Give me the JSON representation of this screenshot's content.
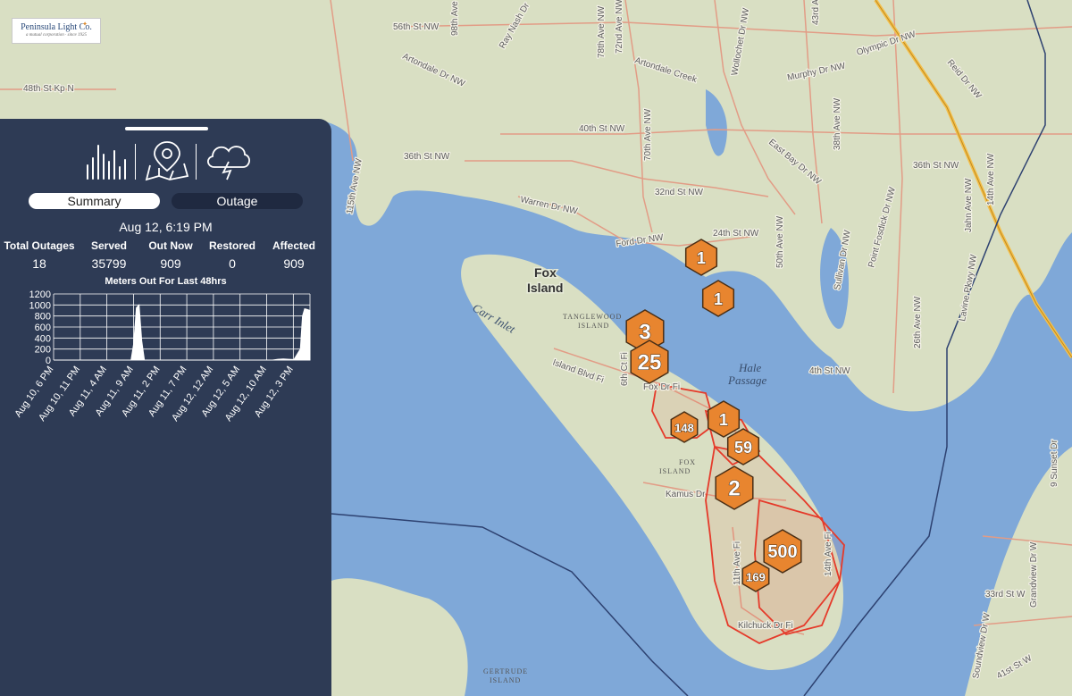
{
  "logo": {
    "name": "Peninsula Light Co.",
    "tagline": "a mutual corporation · since 1925"
  },
  "panel": {
    "icons": [
      "bar-chart-icon",
      "map-pin-icon",
      "storm-cloud-icon"
    ],
    "tabs": {
      "summary": "Summary",
      "outage": "Outage"
    },
    "timestamp": "Aug 12, 6:19 PM",
    "stats": [
      {
        "label": "Total Outages",
        "value": "18"
      },
      {
        "label": "Served",
        "value": "35799"
      },
      {
        "label": "Out Now",
        "value": "909"
      },
      {
        "label": "Restored",
        "value": "0"
      },
      {
        "label": "Affected",
        "value": "909"
      }
    ]
  },
  "chart_data": {
    "type": "area",
    "title": "Meters Out For Last 48hrs",
    "y_ticks": [
      "1200",
      "1000",
      "800",
      "600",
      "400",
      "200",
      "0"
    ],
    "ylim": [
      0,
      1200
    ],
    "categories": [
      "Aug 10, 6 PM",
      "Aug 10, 11 PM",
      "Aug 11, 4 AM",
      "Aug 11, 9 AM",
      "Aug 11, 2 PM",
      "Aug 11, 7 PM",
      "Aug 12, 12 AM",
      "Aug 12, 5 AM",
      "Aug 12, 10 AM",
      "Aug 12, 3 PM"
    ],
    "series": [
      {
        "values_x_hours": [
          0,
          14.5,
          15.0,
          15.5,
          16.0,
          16.5,
          17.0,
          41,
          42,
          43,
          44,
          45,
          46.2,
          46.6,
          47.0,
          47.4,
          48
        ],
        "values": [
          0,
          0,
          300,
          950,
          1000,
          350,
          0,
          0,
          15,
          20,
          15,
          10,
          200,
          800,
          930,
          920,
          900
        ]
      }
    ],
    "grid": true,
    "color": "#ffffff"
  },
  "map": {
    "places": {
      "fox_island": [
        "Fox",
        "Island"
      ],
      "hale_passage": [
        "Hale",
        "Passage"
      ],
      "tanglewood": [
        "TANGLEWOOD",
        "ISLAND"
      ],
      "fox_island_small": [
        "FOX",
        "ISLAND"
      ],
      "gertrude": [
        "GERTRUDE",
        "ISLAND"
      ],
      "carr_inlet": "Carr Inlet"
    },
    "roads": [
      "56th St NW",
      "Artondale Dr NW",
      "Artondale Creek",
      "40th St NW",
      "36th St NW",
      "32nd St NW",
      "24th St NW",
      "Ford Dr NW",
      "Warren Dr NW",
      "Island Blvd Fi",
      "6th Ct Fi",
      "Fox Dr Fi",
      "Kamus Dr",
      "11th Ave Fi",
      "14th Ave Fi",
      "Kilchuck Dr Fi",
      "4th St NW",
      "36th St NW",
      "Point Fosdick Dr NW",
      "26th Ave NW",
      "Sullivan Dr NW",
      "Murphy Dr NW",
      "Olympic Dr NW",
      "Reid Dr NW",
      "14th Ave NW",
      "33rd St W",
      "Grandview Dr W",
      "Soundview Dr W",
      "41st St W",
      "9 Sunset Dr",
      "48th St Kp N",
      "115th Ave NW",
      "98th Ave",
      "78th Ave NW",
      "72nd Ave NW",
      "70th Ave NW",
      "Wollochet Dr NW",
      "East Bay Dr NW",
      "50th Ave NW",
      "38th Ave NW",
      "43rd Av",
      "Jahn Ave NW",
      "Lavine Pkwy NW",
      "Ray Nash Dr"
    ],
    "clusters": [
      {
        "label": "1",
        "size": "s"
      },
      {
        "label": "1",
        "size": "s"
      },
      {
        "label": "3",
        "size": "m"
      },
      {
        "label": "25",
        "size": "m"
      },
      {
        "label": "148",
        "size": "xs"
      },
      {
        "label": "1",
        "size": "s"
      },
      {
        "label": "59",
        "size": "s"
      },
      {
        "label": "2",
        "size": "m"
      },
      {
        "label": "500",
        "size": "m"
      },
      {
        "label": "169",
        "size": "xs"
      }
    ]
  }
}
